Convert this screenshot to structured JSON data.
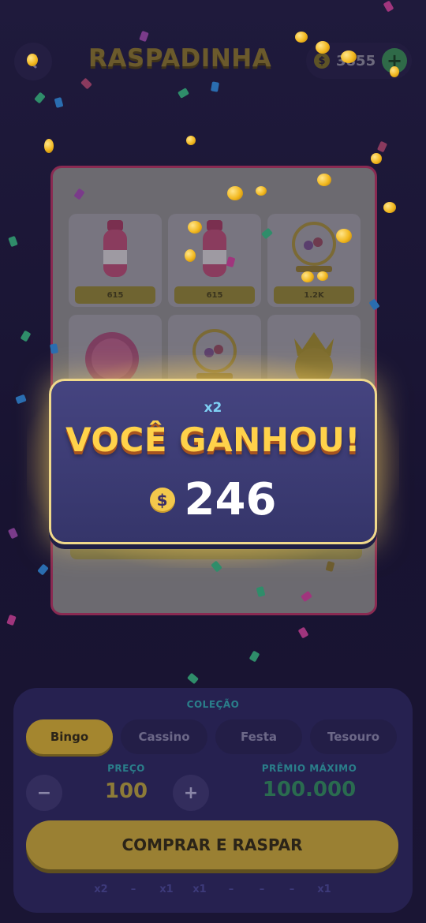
{
  "header": {
    "title": "RASPADINHA",
    "balance": "3855",
    "currency_symbol": "$",
    "add_label": "+"
  },
  "ticket": {
    "cells": [
      {
        "item": "bottle",
        "value": "615"
      },
      {
        "item": "bottle",
        "value": "615"
      },
      {
        "item": "bingo-cage",
        "value": "1.2K"
      },
      {
        "item": "pink-token",
        "value": ""
      },
      {
        "item": "bingo-cage",
        "value": ""
      },
      {
        "item": "crown-ball",
        "value": ""
      }
    ]
  },
  "win": {
    "multiplier": "x2",
    "title": "VOCÊ GANHOU!",
    "currency_symbol": "$",
    "amount": "246"
  },
  "panel": {
    "collection_label": "COLEÇÃO",
    "tabs": [
      {
        "label": "Bingo",
        "active": true
      },
      {
        "label": "Cassino",
        "active": false
      },
      {
        "label": "Festa",
        "active": false
      },
      {
        "label": "Tesouro",
        "active": false
      }
    ],
    "price_label": "PREÇO",
    "price_value": "100",
    "decrease_label": "−",
    "increase_label": "+",
    "max_prize_label": "PRÊMIO MÁXIMO",
    "max_prize_value": "100.000",
    "buy_label": "COMPRAR E RASPAR",
    "multipliers": [
      "x2",
      "–",
      "x1",
      "x1",
      "–",
      "–",
      "–",
      "x1"
    ]
  },
  "colors": {
    "background": "#1c1636",
    "accent_gold": "#ffd24a",
    "banner_blue": "#3d3c78",
    "ticket_border": "#8a2a52",
    "success_green": "#2f6a48"
  }
}
